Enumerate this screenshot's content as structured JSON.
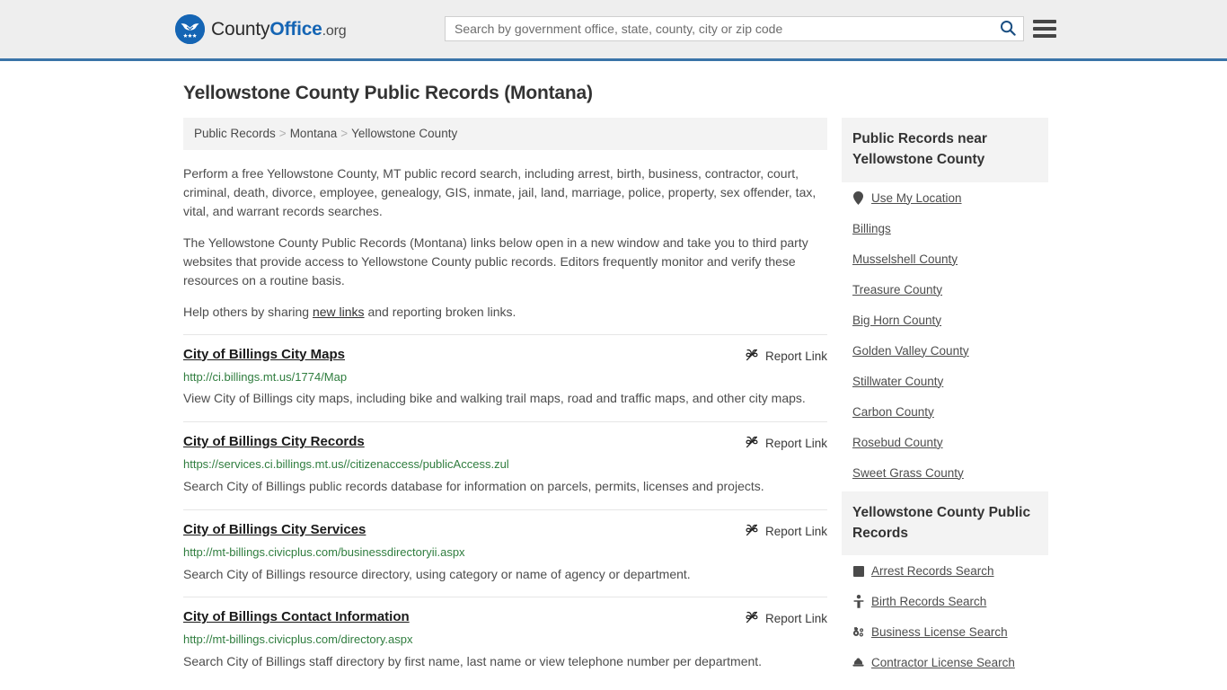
{
  "header": {
    "logo": {
      "icon": "eagle-shield-icon",
      "word1": "County",
      "word2": "Office",
      "suffix": ".org"
    },
    "search": {
      "placeholder": "Search by government office, state, county, city or zip code",
      "value": "",
      "search_icon": "search-icon"
    },
    "menu_icon": "hamburger-menu-icon"
  },
  "page_title": "Yellowstone County Public Records (Montana)",
  "breadcrumb": {
    "items": [
      {
        "label": "Public Records"
      },
      {
        "label": "Montana"
      },
      {
        "label": "Yellowstone County"
      }
    ],
    "separator": ">"
  },
  "intro": {
    "paragraph1": "Perform a free Yellowstone County, MT public record search, including arrest, birth, business, contractor, court, criminal, death, divorce, employee, genealogy, GIS, inmate, jail, land, marriage, police, property, sex offender, tax, vital, and warrant records searches.",
    "paragraph2": "The Yellowstone County Public Records (Montana) links below open in a new window and take you to third party websites that provide access to Yellowstone County public records. Editors frequently monitor and verify these resources on a routine basis.",
    "paragraph3_before": "Help others by sharing ",
    "paragraph3_link": "new links",
    "paragraph3_after": " and reporting broken links."
  },
  "report_link_label": "Report Link",
  "report_link_icon": "broken-link-icon",
  "links": [
    {
      "title": "City of Billings City Maps",
      "url": "http://ci.billings.mt.us/1774/Map",
      "description": "View City of Billings city maps, including bike and walking trail maps, road and traffic maps, and other city maps."
    },
    {
      "title": "City of Billings City Records",
      "url": "https://services.ci.billings.mt.us//citizenaccess/publicAccess.zul",
      "description": "Search City of Billings public records database for information on parcels, permits, licenses and projects."
    },
    {
      "title": "City of Billings City Services",
      "url": "http://mt-billings.civicplus.com/businessdirectoryii.aspx",
      "description": "Search City of Billings resource directory, using category or name of agency or department."
    },
    {
      "title": "City of Billings Contact Information",
      "url": "http://mt-billings.civicplus.com/directory.aspx",
      "description": "Search City of Billings staff directory by first name, last name or view telephone number per department."
    }
  ],
  "sidebar": {
    "nearby": {
      "title": "Public Records near Yellowstone County",
      "items": [
        {
          "label": "Use My Location",
          "icon": "map-pin-icon"
        },
        {
          "label": "Billings",
          "icon": ""
        },
        {
          "label": "Musselshell County",
          "icon": ""
        },
        {
          "label": "Treasure County",
          "icon": ""
        },
        {
          "label": "Big Horn County",
          "icon": ""
        },
        {
          "label": "Golden Valley County",
          "icon": ""
        },
        {
          "label": "Stillwater County",
          "icon": ""
        },
        {
          "label": "Carbon County",
          "icon": ""
        },
        {
          "label": "Rosebud County",
          "icon": ""
        },
        {
          "label": "Sweet Grass County",
          "icon": ""
        }
      ]
    },
    "records": {
      "title": "Yellowstone County Public Records",
      "items": [
        {
          "label": "Arrest Records Search",
          "icon": "fingerprint-square-icon"
        },
        {
          "label": "Birth Records Search",
          "icon": "baby-icon"
        },
        {
          "label": "Business License Search",
          "icon": "gears-icon"
        },
        {
          "label": "Contractor License Search",
          "icon": "hard-hat-icon"
        }
      ]
    }
  },
  "colors": {
    "brand_blue": "#1565b4",
    "header_bg": "#eeeeee",
    "header_rule": "#3a74a8",
    "url_green": "#2f7d3e",
    "panel_bg": "#f3f3f3"
  }
}
